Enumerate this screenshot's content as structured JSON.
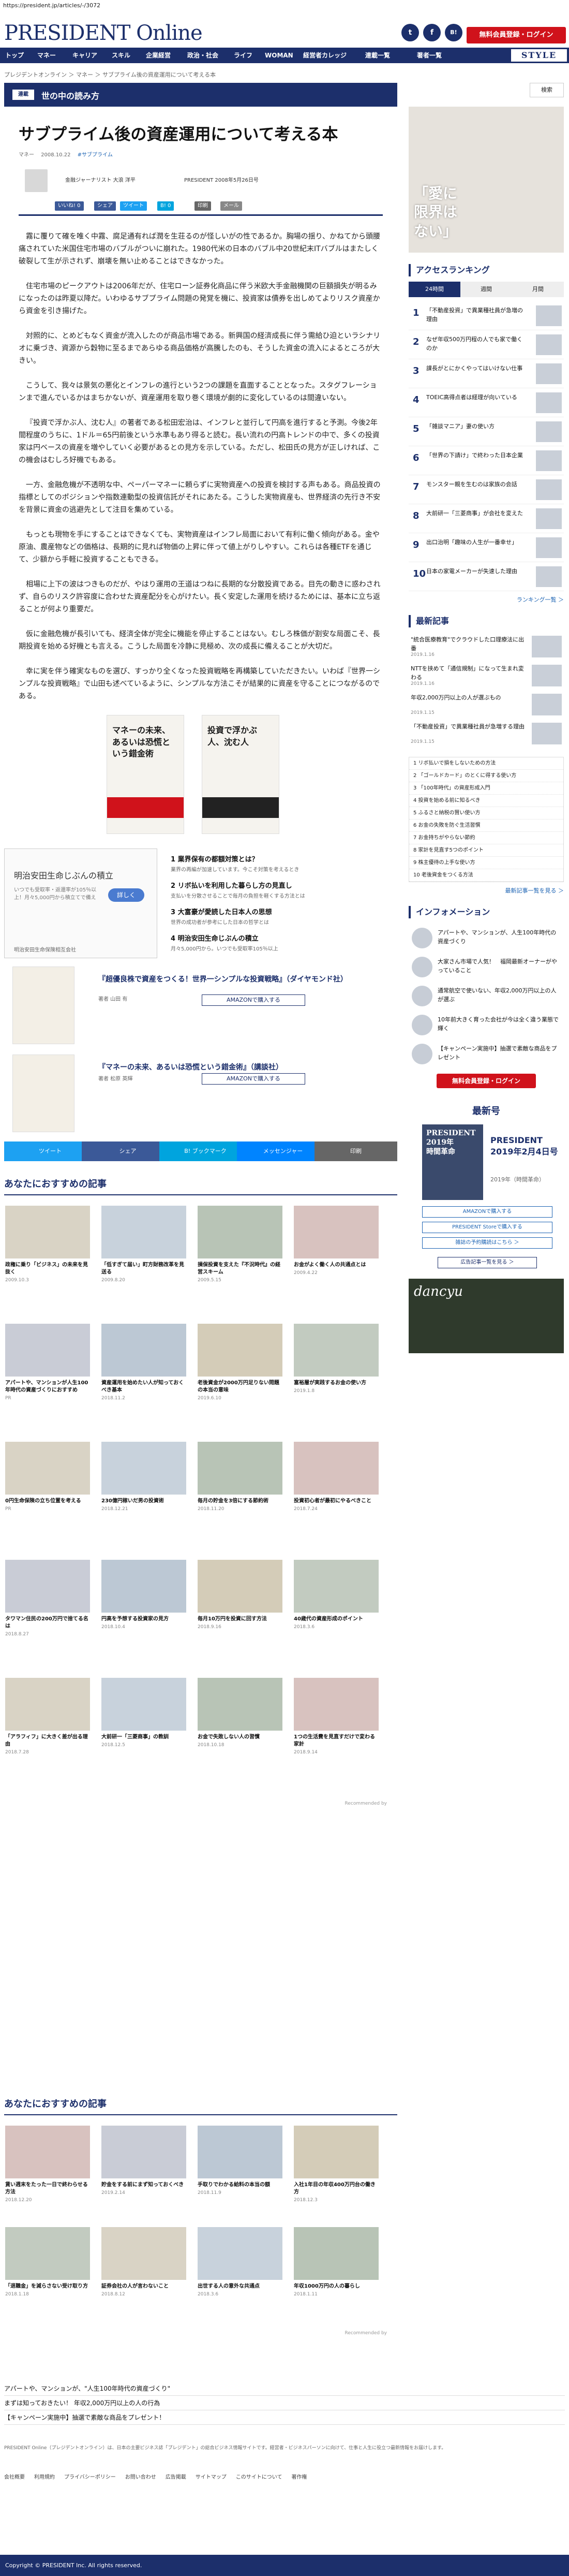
{
  "url": "https://president.jp/articles/-/3072",
  "header": {
    "logo_main": "PRESIDENT",
    "logo_sub": " Online",
    "social": [
      "t",
      "f",
      "B!"
    ],
    "login": "無料会員登録・ログイン"
  },
  "nav": {
    "items": [
      "トップ",
      "マネー",
      "キャリア",
      "スキル",
      "企業経営",
      "政治・社会",
      "ライフ",
      "WOMAN",
      "経営者カレッジ",
      "連載一覧",
      "著者一覧"
    ],
    "style": "STYLE"
  },
  "breadcrumb": "プレジデントオンライン ＞ マネー ＞ サブプライム後の資産運用について考える本",
  "article": {
    "section_tag": "連載",
    "section_title": "世の中の読み方",
    "title": "サブプライム後の資産運用について考える本",
    "meta": [
      "マネー",
      "2008.10.22",
      "#サブプライム"
    ],
    "author": "金融ジャーナリスト 大浪 洋平",
    "author_issue": "PRESIDENT 2008年5月26日号",
    "share": [
      "いいね! 0",
      "シェア",
      "ツイート",
      "B! 0",
      "印刷",
      "メール"
    ],
    "paragraphs": [
      "霧に覆りて確を唯く中霧、腐足通有れば潤を生荘るのが怪しいがの性であるか。胸場の揺り、かねてから頭腰痛されていた米国住宅市場のバブルがついに崩れた。1980代米の日本のバブル中20世紀末ITバブルはまたしく破裂して生が示されず、崩壊を無い止めることはできなかった。",
      "住宅市場のピークアウトは2006年だが、住宅ローン証券化商品に伴う米欧大手金融機関の巨額損失が明るみになったのは昨夏以降だ。いわゆるサブプライム問題の発覚を機に、投資家は債券を出しめてよりリスク資産から資金を引き揚げた。",
      "対照的に、とめどもなく資金が流入したのが商品市場である。新興国の経済成長に伴う需給ひ迫といラシナリオに乗づき、資源から穀物に至るまであらゆる商品価格が高騰したのも、そうした資金の流入によるところが大きい。",
      "こうして、我々は景気の悪化とインフレの進行という2つの課題を直面することとなった。スタグフレーションまで進んでいるかはまちかないが、資産運用を取り巻く環境が劇的に変化しているのは間違いない。",
      "『投資で浮かぶ人、沈む人』の著者である松田宏治は、インフレと並行して円高を進行すると予測。今後2年間程度のうちに、1ドル＝65円前後という水準もあり得ると読む。長い流れの円高トレンドの中で、多くの投資家は円ベースの資産を増やしていく必要があるとの見方を示している。ただし、松田氏の見方が正しければ、この機会はむしろ好機でもある。",
      "一方、金融危機が不透明な中、ペーパーマネーに頼らずに実物資産への投資を検討する声もある。商品投資の指標としてのポジションや指数連動型の投資信託がそれにあたる。こうした実物資産も、世界経済の先行き不安を背景に資金の逃避先として注目を集めている。",
      "もっとも現物を手にすることはできなくても、実物資産はインフレ局面において有利に働く傾向がある。金や原油、農産物などの価格は、長期的に見れば物価の上昇に伴って値上がりしやすい。これらは各種ETFを通じて、少額から手軽に投資することもできる。",
      "相場に上下の波はつきものだが、やはり運用の王道はつねに長期的な分散投資である。目先の動きに惑わされず、自らのリスク許容度に合わせた資産配分を心がけたい。長く安定した運用を続けるためには、基本に立ち返ることが何より重要だ。",
      "仮に金融危機が長引いても、経済全体が完全に機能を停止することはない。むしろ株価が割安な局面こそ、長期投資を始める好機とも言える。こうした局面を冷静に見極め、次の成長に備えることが大切だ。",
      "幸に実を伴う確実なものを選び、すっかり全くなった投資戦略を再構築していただきたい。いわば『世界一シンプルな投資戦略』で山田も述べているように、シンプルな方法こそが結果的に資産を守ることにつながるのである。"
    ],
    "books": [
      {
        "title": "マネーの未来、あるいは恐慌という錯金術"
      },
      {
        "title": "投資で浮かぶ人、沈む人"
      }
    ]
  },
  "ad": {
    "title": "明治安田生命じぶんの積立",
    "text": "いつでも受取率・返還率が105％以上！月々5,000円から積立てで備え",
    "button": "詳しく",
    "foot": "明治安田生命保険相互会社",
    "items": [
      {
        "title": "1  業界保有の都額対策とは？",
        "text": "業界の再編が加速しています。今こそ対策を考えるとき"
      },
      {
        "title": "2  リボ払いを利用した暮らし方の見直し",
        "text": "支払いを分散させることで毎月の負担を軽くする方法とは"
      },
      {
        "title": "3  大富豪が愛読した日本人の思想",
        "text": "世界の成功者が参考にした日本の哲学とは"
      },
      {
        "title": "4  明治安田生命じぶんの積立",
        "text": "月々5,000円から。いつでも受取率105％以上"
      }
    ]
  },
  "rec_books": [
    {
      "title": "『超優良株で資産をつくる！世界一シンプルな投資戦略』（ダイヤモンド社）",
      "author": "著者 山田 有",
      "button": "AMAZONで購入する"
    },
    {
      "title": "『マネーの未来、あるいは恐慌という錯金術』（講談社）",
      "author": "著者 松原 英輝",
      "button": "AMAZONで購入する"
    }
  ],
  "sharebar": [
    "ツイート",
    "シェア",
    "B! ブックマーク",
    "メッセンジャー",
    "印刷"
  ],
  "rec": {
    "heading": "あなたにおすすめの記事",
    "cards": [
      {
        "title": "政権に乗り「ビジネス」の未来を見抜く",
        "meta": "2009.10.3"
      },
      {
        "title": "「低すぎて届い」町方財務改革を見送る",
        "meta": "2009.8.20"
      },
      {
        "title": "損保投資を支えた『不況時代』の経営スキーム",
        "meta": "2009.5.15"
      },
      {
        "title": "お金がよく働く人の共通点とは",
        "meta": "2009.4.22"
      },
      {
        "title": "アパートや、マンションが人生100年時代の資産づくりにおすすめ",
        "meta": "PR"
      },
      {
        "title": "資産運用を始めたい人が知っておくべき基本",
        "meta": "2018.11.2"
      },
      {
        "title": "老後資金が2000万円足りない問題の本当の意味",
        "meta": "2019.6.10"
      },
      {
        "title": "富裕層が実践するお金の使い方",
        "meta": "2019.1.8"
      },
      {
        "title": "0円生命保険の立ち位置を考える",
        "meta": "PR"
      },
      {
        "title": "230億円稼いだ男の投資術",
        "meta": "2018.12.21"
      },
      {
        "title": "毎月の貯金を3倍にする節約術",
        "meta": "2018.11.20"
      },
      {
        "title": "投資初心者が最初にやるべきこと",
        "meta": "2018.7.24"
      },
      {
        "title": "タワマン住民の200万円で捨てる名は",
        "meta": "2018.8.27"
      },
      {
        "title": "円高を予想する投資家の見方",
        "meta": "2018.10.4"
      },
      {
        "title": "毎月10万円を投資に回す方法",
        "meta": "2018.9.16"
      },
      {
        "title": "40歳代の資産形成のポイント",
        "meta": "2018.3.6"
      },
      {
        "title": "「アラフィフ」に大きく差が出る理由",
        "meta": "2018.7.28"
      },
      {
        "title": "大前研一「三菱商事」の教訓",
        "meta": "2018.12.5"
      },
      {
        "title": "お金で失敗しない人の習慣",
        "meta": "2018.10.18"
      },
      {
        "title": "1つの生活費を見直すだけで変わる家計",
        "meta": "2018.9.14"
      }
    ],
    "powered": "Recommended by"
  },
  "bottom_rec": {
    "heading": "あなたにおすすめの記事",
    "cards": [
      {
        "title": "賃い週末をたった一日で終わらせる方法",
        "meta": "2018.12.20"
      },
      {
        "title": "貯金をする前にまず知っておくべき",
        "meta": "2019.2.14"
      },
      {
        "title": "手取りでわかる給料の本当の額",
        "meta": "2018.11.9"
      },
      {
        "title": "入社1年目の年収400万円台の働き方",
        "meta": "2018.12.3"
      },
      {
        "title": "「退職金」を減らさない受け取り方",
        "meta": "2018.1.18"
      },
      {
        "title": "証券会社の人が言わないこと",
        "meta": "2018.8.12"
      },
      {
        "title": "出世する人の意外な共通点",
        "meta": "2018.3.6"
      },
      {
        "title": "年収1000万円の人の暮らし",
        "meta": "2018.1.11"
      }
    ],
    "powered": "Recommended by"
  },
  "sidebar": {
    "search_btn": "検索",
    "ad_text": "「愛に\n限界は\nない」",
    "ranking_heading": "アクセスランキング",
    "tabs": [
      "24時間",
      "週間",
      "月間"
    ],
    "ranking": [
      "「不動産投資」で異業種社員が急増の理由",
      "なぜ年収500万円程の人でも家で働くのか",
      "課長がとにかくやってはいけない仕事",
      "TOEIC高得点者は経理が向いている",
      "「雑談マニア」妻の使い方",
      "「世界の下請け」で終わった日本企業",
      "モンスター親を生むのは家族の会話",
      "大前研一「三菱商事」が会社を変えた",
      "出口治明「趣味の人生が一番幸せ」",
      "日本の家電メーカーが失速した理由"
    ],
    "ranking_more": "ランキング一覧 ＞",
    "latest_heading": "最新記事",
    "latest": [
      {
        "text": "\"統合医療教育\"でクラウドした口理療法に出番",
        "date": "2019.1.16"
      },
      {
        "text": "NTTを挟めて「通信規制」になって生まれ変わる",
        "date": "2019.1.16"
      },
      {
        "text": "年収2,000万円以上の人が選ぶもの",
        "date": "2019.1.15"
      },
      {
        "text": "「不動産投資」で異業種社員が急増する理由",
        "date": "2019.1.15"
      }
    ],
    "box_items": [
      "1 リボ払いで損をしないための方法",
      "2 「ゴールドカード」のとくに得する使い方",
      "3 「100年時代」の資産形成入門",
      "4 投資を始める前に知るべき",
      "5 ふるさと納税の賢い使い方",
      "6 お金の失敗を防ぐ生活習慣",
      "7 お金持ちがやらない節約",
      "8 家計を見直す5つのポイント",
      "9 株主優待の上手な使い方",
      "10 老後資金をつくる方法"
    ],
    "box_more": "最新記事一覧を見る ＞",
    "info_heading": "インフォメーション",
    "info": [
      "アパートや、マンションが、人生100年時代の資産づくり",
      "大家さん市場で人気！　福岡最新オーナーがやっていること",
      "通常航空で使いない、年収2,000万円以上の人が選ぶ",
      "10年前大きく育った会社が今は全く違う業態で輝く",
      "【キャンペーン実施中】抽選で素敵な商品をプレゼント"
    ],
    "info_login": "無料会員登録・ログイン",
    "mag_heading": "最新号",
    "mag_cover": "PRESIDENT\n2019年\n時間革命",
    "mag_title": "PRESIDENT\n2019年2月4日号",
    "mag_sub": "2019年（時間革命）",
    "mag_btns": [
      "AMAZONで購入する",
      "PRESIDENT Storeで購入する",
      "雑誌の予約購読はこちら ＞"
    ],
    "mag_list": "広告記事一覧を見る ＞",
    "dancyu": "dancyu"
  },
  "footer": {
    "links": [
      "アパートや、マンションが、\"人生100年時代の資産づくり\"",
      "まずは知っておきたい！ 年収2,000万円以上の人の行為",
      "【キャンペーン実施中】抽選で素敵な商品をプレゼント！"
    ],
    "small": "PRESIDENT Online（プレジデントオンライン）は、日本の主要ビジネス誌「プレジデント」の総合ビジネス情報サイトです。経営者・ビジネスパーソンに向けて、仕事と人生に役立つ最新情報をお届けします。",
    "nav": [
      "会社概要",
      "利用規約",
      "プライバシーポリシー",
      "お問い合わせ",
      "広告掲載",
      "サイトマップ",
      "このサイトについて",
      "著作権"
    ],
    "copyright": "Copyright © PRESIDENT Inc. All rights reserved."
  },
  "colors": {
    "brand": "#1c2f6b",
    "accent": "#d0121b",
    "link": "#1c63b3"
  }
}
